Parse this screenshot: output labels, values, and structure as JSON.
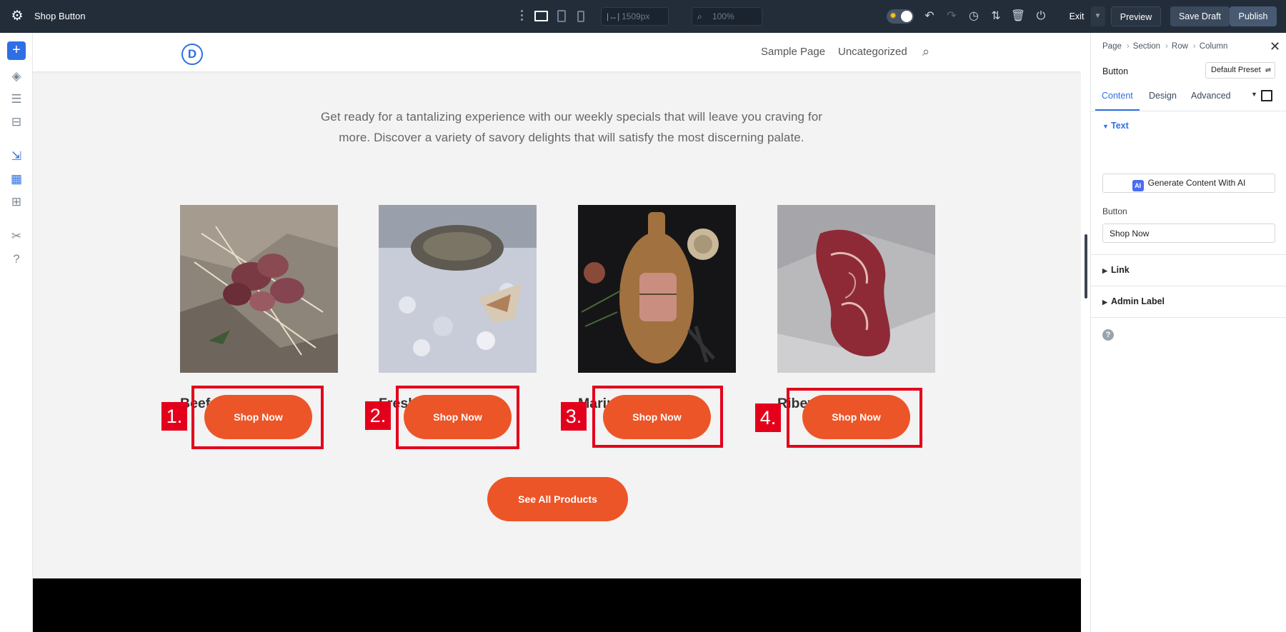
{
  "topbar": {
    "title": "Shop Button",
    "width_field": "1509px",
    "zoom_field": "100%",
    "exit_label": "Exit",
    "preview_label": "Preview",
    "save_draft_label": "Save Draft",
    "publish_label": "Publish"
  },
  "site": {
    "logo_letter": "D",
    "nav": [
      "Sample Page",
      "Uncategorized"
    ],
    "intro_text": "Get ready for a tantalizing experience with our weekly specials that will leave you craving for more. Discover a variety of savory delights that will satisfy the most discerning palate.",
    "products": [
      {
        "name": "Beef Skewers",
        "button": "Shop Now",
        "badge": "1."
      },
      {
        "name": "Fresh Crab",
        "button": "Shop Now",
        "badge": "2."
      },
      {
        "name": "Marinated TriTip",
        "button": "Shop Now",
        "badge": "3."
      },
      {
        "name": "Ribeye",
        "button": "Shop Now",
        "badge": "4."
      }
    ],
    "see_all_label": "See All Products"
  },
  "panel": {
    "breadcrumbs": [
      "Page",
      "Section",
      "Row",
      "Column"
    ],
    "title": "Button",
    "preset": "Default Preset",
    "tabs": [
      "Content",
      "Design",
      "Advanced"
    ],
    "sections": {
      "text": "Text",
      "link": "Link",
      "admin_label": "Admin Label"
    },
    "ai_button": "Generate Content With AI",
    "ai_badge": "AI",
    "button_field_label": "Button",
    "button_field_value": "Shop Now"
  },
  "colors": {
    "accent": "#ec5528",
    "highlight": "#e4001b",
    "builder_blue": "#2f6fe5",
    "topbar": "#232d3a"
  }
}
